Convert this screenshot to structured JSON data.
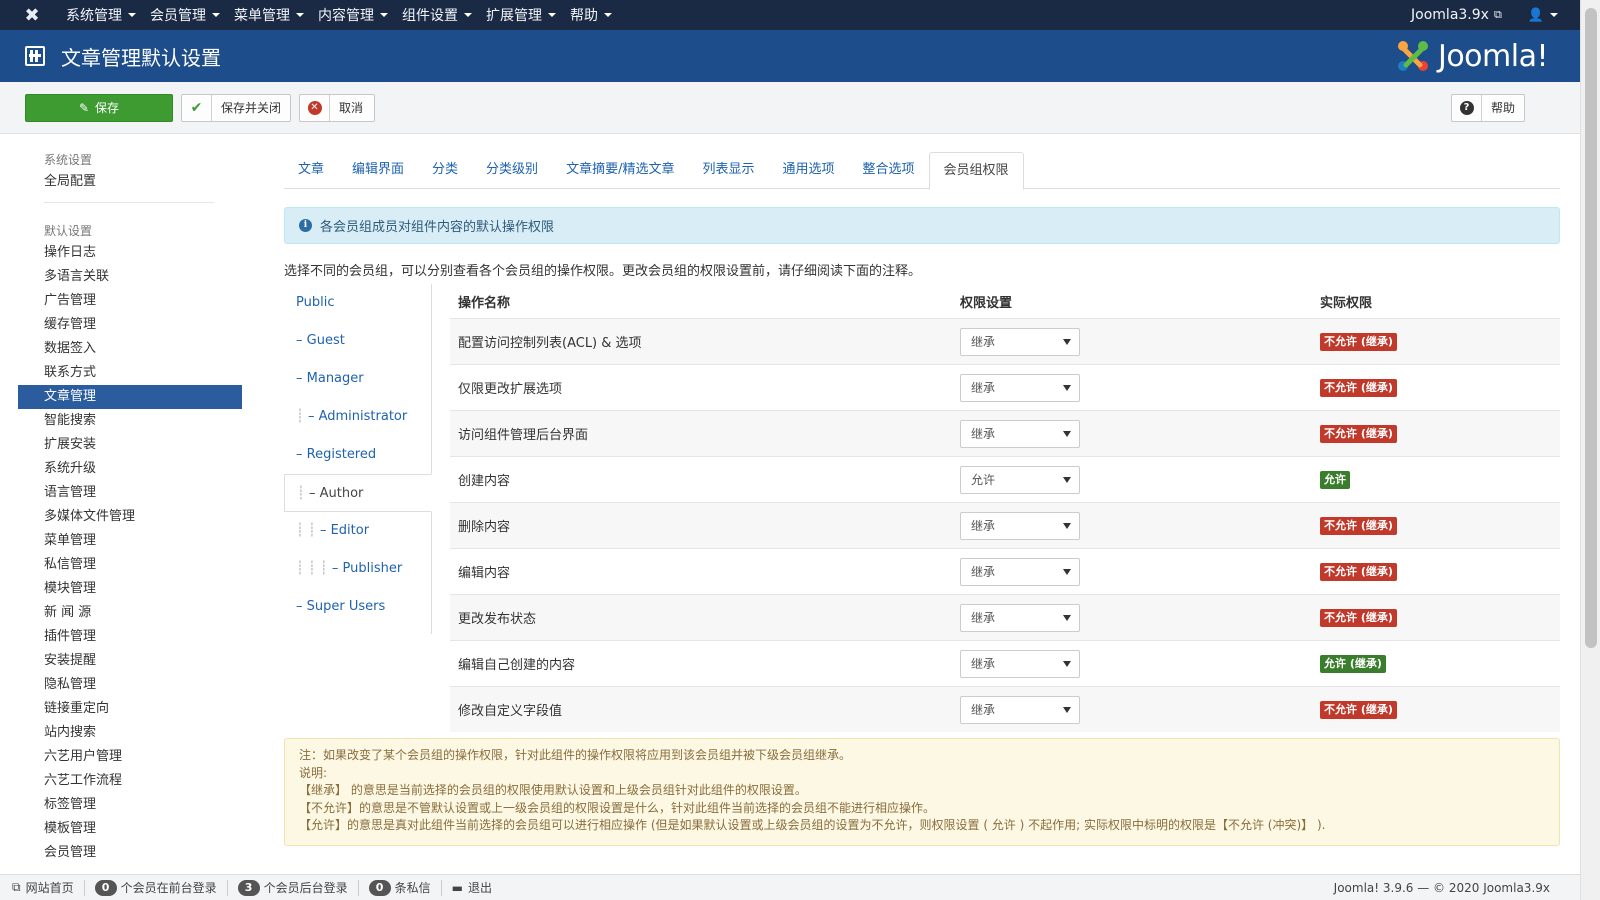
{
  "navbar": {
    "menu": [
      "系统管理",
      "会员管理",
      "菜单管理",
      "内容管理",
      "组件设置",
      "扩展管理",
      "帮助"
    ],
    "site_link": "Joomla3.9x"
  },
  "header": {
    "title": "文章管理默认设置",
    "brand": "Joomla!"
  },
  "toolbar": {
    "save": "保存",
    "save_close": "保存并关闭",
    "cancel": "取消",
    "help": "帮助"
  },
  "sidebar": {
    "section1_head": "系统设置",
    "section1_items": [
      "全局配置"
    ],
    "section2_head": "默认设置",
    "section2_items": [
      "操作日志",
      "多语言关联",
      "广告管理",
      "缓存管理",
      "数据签入",
      "联系方式",
      "文章管理",
      "智能搜索",
      "扩展安装",
      "系统升级",
      "语言管理",
      "多媒体文件管理",
      "菜单管理",
      "私信管理",
      "模块管理",
      "新 闻 源",
      "插件管理",
      "安装提醒",
      "隐私管理",
      "链接重定向",
      "站内搜索",
      "六艺用户管理",
      "六艺工作流程",
      "标签管理",
      "模板管理",
      "会员管理"
    ],
    "active": "文章管理"
  },
  "tabs": [
    "文章",
    "编辑界面",
    "分类",
    "分类级别",
    "文章摘要/精选文章",
    "列表显示",
    "通用选项",
    "整合选项",
    "会员组权限"
  ],
  "active_tab": "会员组权限",
  "info": "各会员组成员对组件内容的默认操作权限",
  "description": "选择不同的会员组，可以分别查看各个会员组的操作权限。更改会员组的权限设置前，请仔细阅读下面的注释。",
  "groups": [
    {
      "label": "Public",
      "dots": ""
    },
    {
      "label": "– Guest",
      "dots": ""
    },
    {
      "label": "– Manager",
      "dots": ""
    },
    {
      "label": "– Administrator",
      "dots": "┊"
    },
    {
      "label": "– Registered",
      "dots": ""
    },
    {
      "label": "– Author",
      "dots": "┊"
    },
    {
      "label": "– Editor",
      "dots": "┊ ┊"
    },
    {
      "label": "– Publisher",
      "dots": "┊ ┊ ┊"
    },
    {
      "label": "– Super Users",
      "dots": ""
    }
  ],
  "active_group": "– Author",
  "table": {
    "headers": [
      "操作名称",
      "权限设置",
      "实际权限"
    ],
    "rows": [
      {
        "action": "配置访问控制列表(ACL) & 选项",
        "setting": "继承",
        "result": "不允许 (继承)",
        "status": "deny"
      },
      {
        "action": "仅限更改扩展选项",
        "setting": "继承",
        "result": "不允许 (继承)",
        "status": "deny"
      },
      {
        "action": "访问组件管理后台界面",
        "setting": "继承",
        "result": "不允许 (继承)",
        "status": "deny"
      },
      {
        "action": "创建内容",
        "setting": "允许",
        "result": "允许",
        "status": "allow"
      },
      {
        "action": "删除内容",
        "setting": "继承",
        "result": "不允许 (继承)",
        "status": "deny"
      },
      {
        "action": "编辑内容",
        "setting": "继承",
        "result": "不允许 (继承)",
        "status": "deny"
      },
      {
        "action": "更改发布状态",
        "setting": "继承",
        "result": "不允许 (继承)",
        "status": "deny"
      },
      {
        "action": "编辑自己创建的内容",
        "setting": "继承",
        "result": "允许 (继承)",
        "status": "allow"
      },
      {
        "action": "修改自定义字段值",
        "setting": "继承",
        "result": "不允许 (继承)",
        "status": "deny"
      }
    ]
  },
  "note": [
    "注：如果改变了某个会员组的操作权限，针对此组件的操作权限将应用到该会员组并被下级会员组继承。",
    "说明:",
    "【继承】 的意思是当前选择的会员组的权限使用默认设置和上级会员组针对此组件的权限设置。",
    "【不允许】的意思是不管默认设置或上一级会员组的权限设置是什么，针对此组件当前选择的会员组不能进行相应操作。",
    "【允许】的意思是真对此组件当前选择的会员组可以进行相应操作 (但是如果默认设置或上级会员组的设置为不允许，则权限设置 ( 允许 ) 不起作用; 实际权限中标明的权限是【不允许 (冲突)】 )."
  ],
  "footer": {
    "site": "网站首页",
    "frontend_count": "0",
    "frontend_label": "个会员在前台登录",
    "backend_count": "3",
    "backend_label": "个会员后台登录",
    "msg_count": "0",
    "msg_label": "条私信",
    "logout": "退出",
    "copyright": "Joomla! 3.9.6 — © 2020 Joomla3.9x"
  },
  "colors": {
    "deny": "#c0392b",
    "allow": "#3a7d2c",
    "header": "#1d4d8a",
    "navbar": "#1a2a45"
  }
}
